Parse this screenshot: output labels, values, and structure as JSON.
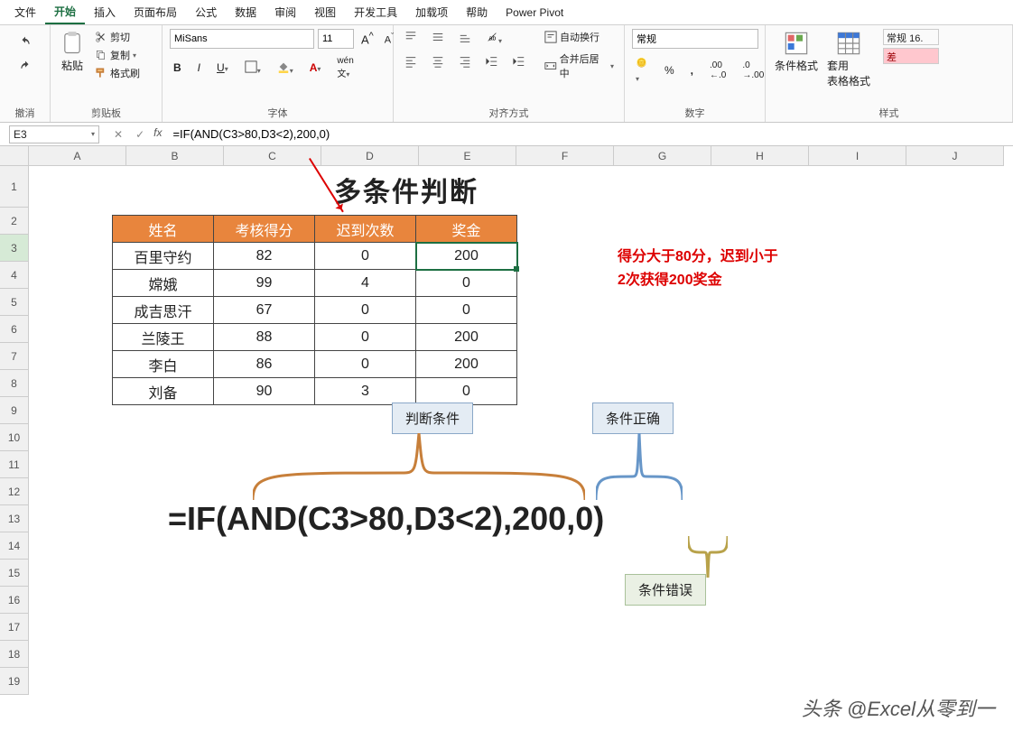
{
  "tabs": [
    "文件",
    "开始",
    "插入",
    "页面布局",
    "公式",
    "数据",
    "审阅",
    "视图",
    "开发工具",
    "加载项",
    "帮助",
    "Power Pivot"
  ],
  "active_tab": "开始",
  "ribbon": {
    "undo_group": "撤消",
    "clipboard": {
      "paste": "粘贴",
      "cut": "剪切",
      "copy": "复制",
      "format_painter": "格式刷",
      "group": "剪贴板"
    },
    "font": {
      "name": "MiSans",
      "size": "11",
      "group": "字体"
    },
    "alignment": {
      "wrap": "自动换行",
      "merge": "合并后居中",
      "group": "对齐方式"
    },
    "number": {
      "format": "常规",
      "group": "数字"
    },
    "styles": {
      "cond": "条件格式",
      "table": "套用\n表格格式",
      "normal": "常规 16.",
      "bad": "差",
      "group": "样式"
    }
  },
  "name_box": "E3",
  "formula_bar": "=IF(AND(C3>80,D3<2),200,0)",
  "columns": [
    "A",
    "B",
    "C",
    "D",
    "E",
    "F",
    "G",
    "H",
    "I",
    "J"
  ],
  "row_count": 19,
  "sheet": {
    "title": "多条件判断",
    "headers": [
      "姓名",
      "考核得分",
      "迟到次数",
      "奖金"
    ],
    "rows": [
      [
        "百里守约",
        "82",
        "0",
        "200"
      ],
      [
        "嫦娥",
        "99",
        "4",
        "0"
      ],
      [
        "成吉思汗",
        "67",
        "0",
        "0"
      ],
      [
        "兰陵王",
        "88",
        "0",
        "200"
      ],
      [
        "李白",
        "86",
        "0",
        "200"
      ],
      [
        "刘备",
        "90",
        "3",
        "0"
      ]
    ],
    "note_line1": "得分大于80分，迟到小于",
    "note_line2": "2次获得200奖金",
    "callout_cond": "判断条件",
    "callout_true": "条件正确",
    "callout_false": "条件错误",
    "big_formula": "=IF(AND(C3>80,D3<2),200,0)"
  },
  "watermark": "头条 @Excel从零到一",
  "chart_data": {
    "type": "table",
    "title": "多条件判断",
    "columns": [
      "姓名",
      "考核得分",
      "迟到次数",
      "奖金"
    ],
    "rows": [
      {
        "姓名": "百里守约",
        "考核得分": 82,
        "迟到次数": 0,
        "奖金": 200
      },
      {
        "姓名": "嫦娥",
        "考核得分": 99,
        "迟到次数": 4,
        "奖金": 0
      },
      {
        "姓名": "成吉思汗",
        "考核得分": 67,
        "迟到次数": 0,
        "奖金": 0
      },
      {
        "姓名": "兰陵王",
        "考核得分": 88,
        "迟到次数": 0,
        "奖金": 200
      },
      {
        "姓名": "李白",
        "考核得分": 86,
        "迟到次数": 0,
        "奖金": 200
      },
      {
        "姓名": "刘备",
        "考核得分": 90,
        "迟到次数": 3,
        "奖金": 0
      }
    ],
    "formula": "=IF(AND(C3>80,D3<2),200,0)",
    "rule": "得分大于80分，迟到小于2次获得200奖金"
  }
}
